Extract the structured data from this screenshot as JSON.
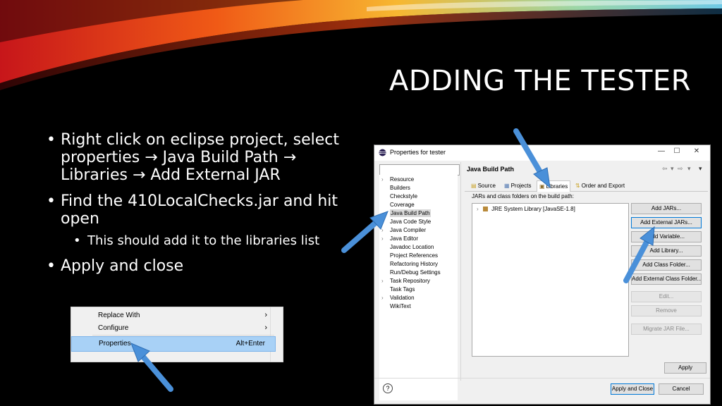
{
  "slide": {
    "title": "ADDING THE TESTER",
    "bullets": [
      "Right click on eclipse project, select properties → Java Build Path → Libraries → Add External JAR",
      "Find the 410LocalChecks.jar and hit open",
      "Apply and close"
    ],
    "sub_bullet": "This should add it to the libraries list"
  },
  "context_menu": {
    "items": [
      {
        "label": "Replace With",
        "submenu": "›"
      },
      {
        "label": "Configure",
        "submenu": "›"
      },
      {
        "label": "Properties",
        "shortcut": "Alt+Enter"
      }
    ]
  },
  "dialog": {
    "title": "Properties for tester",
    "window_buttons": {
      "minimize": "—",
      "maximize": "☐",
      "close": "✕"
    },
    "filter_value": "",
    "tree": [
      {
        "label": "Resource",
        "twistie": "›"
      },
      {
        "label": "Builders",
        "twistie": ""
      },
      {
        "label": "Checkstyle",
        "twistie": ""
      },
      {
        "label": "Coverage",
        "twistie": ""
      },
      {
        "label": "Java Build Path",
        "twistie": "",
        "selected": true
      },
      {
        "label": "Java Code Style",
        "twistie": "›"
      },
      {
        "label": "Java Compiler",
        "twistie": "›"
      },
      {
        "label": "Java Editor",
        "twistie": "›"
      },
      {
        "label": "Javadoc Location",
        "twistie": ""
      },
      {
        "label": "Project References",
        "twistie": ""
      },
      {
        "label": "Refactoring History",
        "twistie": ""
      },
      {
        "label": "Run/Debug Settings",
        "twistie": ""
      },
      {
        "label": "Task Repository",
        "twistie": "›"
      },
      {
        "label": "Task Tags",
        "twistie": ""
      },
      {
        "label": "Validation",
        "twistie": "›"
      },
      {
        "label": "WikiText",
        "twistie": ""
      }
    ],
    "panel_title": "Java Build Path",
    "nav": {
      "back": "⇦",
      "dropdown": "▾",
      "forward": "⇨",
      "menu": "▾"
    },
    "tabs": [
      {
        "label": "Source",
        "icon": "▤"
      },
      {
        "label": "Projects",
        "icon": "▦"
      },
      {
        "label": "Libraries",
        "icon": "▣",
        "active": true
      },
      {
        "label": "Order and Export",
        "icon": "⇅"
      }
    ],
    "list_label": "JARs and class folders on the build path:",
    "list_items": [
      {
        "label": "JRE System Library [JavaSE-1.8]",
        "twistie": "›"
      }
    ],
    "buttons": [
      {
        "label": "Add JARs...",
        "enabled": true
      },
      {
        "label": "Add External JARs...",
        "enabled": true,
        "focused": true
      },
      {
        "label": "Add Variable...",
        "enabled": true
      },
      {
        "label": "Add Library...",
        "enabled": true
      },
      {
        "label": "Add Class Folder...",
        "enabled": true
      },
      {
        "label": "Add External Class Folder...",
        "enabled": true
      },
      {
        "label": "Edit...",
        "enabled": false
      },
      {
        "label": "Remove",
        "enabled": false
      },
      {
        "label": "Migrate JAR File...",
        "enabled": false
      }
    ],
    "apply_label": "Apply",
    "help_icon": "?",
    "apply_close_label": "Apply and Close",
    "cancel_label": "Cancel"
  },
  "colors": {
    "background": "#000000",
    "selection": "#a8d1f6",
    "arrow": "#4a90d9",
    "focus": "#0078d7"
  }
}
